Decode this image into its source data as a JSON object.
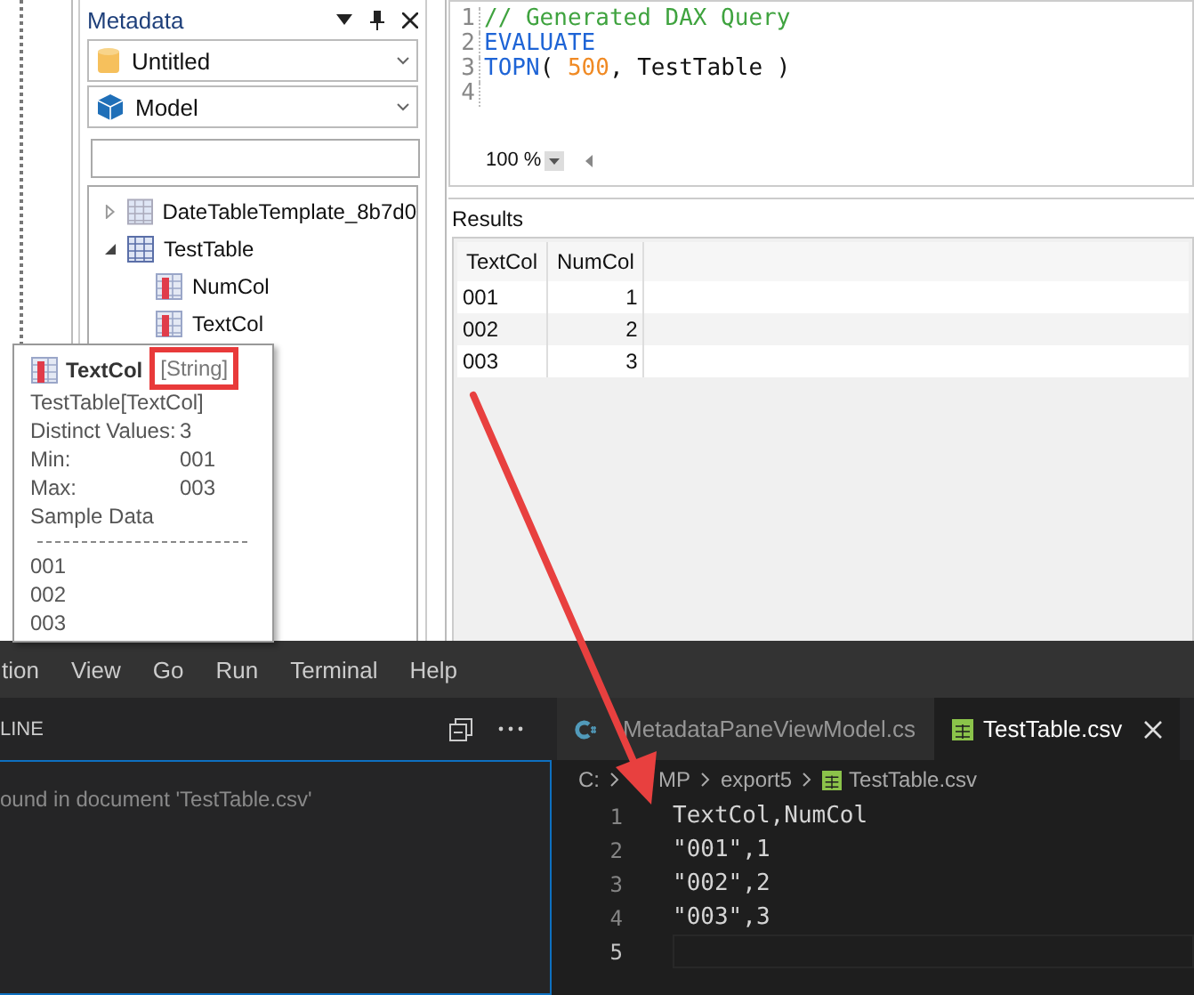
{
  "metadata_pane": {
    "title": "Metadata",
    "connection": {
      "value": "Untitled"
    },
    "model": {
      "value": "Model"
    },
    "tree": [
      {
        "label": "DateTableTemplate_8b7d0",
        "expanded": false
      },
      {
        "label": "TestTable",
        "expanded": true,
        "children": [
          {
            "label": "NumCol"
          },
          {
            "label": "TextCol"
          }
        ]
      }
    ]
  },
  "query_editor": {
    "lines": [
      {
        "number": "1",
        "tokens": [
          {
            "kind": "comment",
            "text": "// Generated DAX Query"
          }
        ]
      },
      {
        "number": "2",
        "tokens": [
          {
            "kind": "keyword",
            "text": "EVALUATE"
          }
        ]
      },
      {
        "number": "3",
        "tokens": [
          {
            "kind": "keyword",
            "text": "TOPN"
          },
          {
            "kind": "plain",
            "text": "( "
          },
          {
            "kind": "number",
            "text": "500"
          },
          {
            "kind": "plain",
            "text": ", TestTable )"
          }
        ]
      },
      {
        "number": "4"
      }
    ],
    "zoom": "100 %"
  },
  "results": {
    "title": "Results",
    "columns": [
      "TextCol",
      "NumCol"
    ],
    "rows": [
      [
        "001",
        "1"
      ],
      [
        "002",
        "2"
      ],
      [
        "003",
        "3"
      ]
    ]
  },
  "tooltip": {
    "name": "TextCol",
    "type": "[String]",
    "type_highlighted": true,
    "reference": "TestTable[TextCol]",
    "stats": [
      {
        "label": "Distinct Values:",
        "value": "3"
      },
      {
        "label": "Min:",
        "value": "001"
      },
      {
        "label": "Max:",
        "value": "003"
      }
    ],
    "sample_title": "Sample Data",
    "samples": [
      "001",
      "002",
      "003"
    ]
  },
  "vscode": {
    "menu": [
      "tion",
      "View",
      "Go",
      "Run",
      "Terminal",
      "Help"
    ],
    "sidebar": {
      "title": "LINE",
      "message": "ound in document 'TestTable.csv'"
    },
    "tabs": [
      {
        "label": "MetadataPaneViewModel.cs",
        "kind": "csharp",
        "selected": false
      },
      {
        "label": "TestTable.csv",
        "kind": "csv",
        "selected": true
      }
    ],
    "breadcrumb": [
      "C:",
      "MP",
      "export5",
      "TestTable.csv"
    ],
    "lines": [
      {
        "number": "1",
        "text": "TextCol,NumCol"
      },
      {
        "number": "2",
        "text": "\"001\",1"
      },
      {
        "number": "3",
        "text": "\"002\",2"
      },
      {
        "number": "4",
        "text": "\"003\",3"
      },
      {
        "number": "5",
        "current": true
      }
    ]
  }
}
